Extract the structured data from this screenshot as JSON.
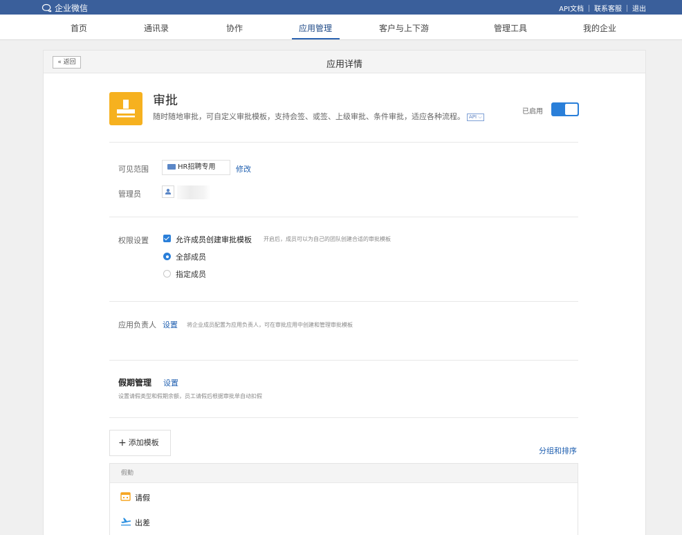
{
  "topbar": {
    "logo_text": "企业微信",
    "links": [
      "API文档",
      "联系客服",
      "退出"
    ]
  },
  "nav": {
    "items": [
      "首页",
      "通讯录",
      "协作",
      "应用管理",
      "客户与上下游",
      "管理工具",
      "我的企业"
    ],
    "active": "应用管理"
  },
  "page": {
    "back_label": "« 返回",
    "title": "应用详情"
  },
  "app": {
    "name": "审批",
    "description": "随时随地审批，可自定义审批模板，支持会签、或签、上级审批、条件审批，适应各种流程。",
    "api_tag": "API",
    "status_label": "已启用",
    "enabled": true,
    "icon_color": "#f6b11f"
  },
  "visibility": {
    "label": "可见范围",
    "value": "HR招聘专用",
    "edit_label": "修改"
  },
  "admin": {
    "label": "管理员"
  },
  "permission": {
    "label": "权限设置",
    "checkbox_label": "允许成员创建审批模板",
    "checkbox_checked": true,
    "hint": "开启后，成员可以为自己的团队创建合适的审批模板",
    "options": [
      "全部成员",
      "指定成员"
    ],
    "selected": "全部成员"
  },
  "owner": {
    "label": "应用负责人",
    "link_label": "设置",
    "hint": "将企业成员配置为应用负责人，可在审批应用中创建和管理审批模板"
  },
  "leave": {
    "title": "假期管理",
    "link_label": "设置",
    "hint": "设置请假类型和假期余额，员工请假后根据审批单自动扣假"
  },
  "templates": {
    "add_label": "添加模板",
    "group_sort_label": "分组和排序",
    "group_name": "假勤",
    "items": [
      {
        "name": "请假",
        "icon": "calendar-icon"
      },
      {
        "name": "出差",
        "icon": "airplane-icon"
      }
    ]
  },
  "colors": {
    "topbar": "#3a5f9b",
    "accent": "#2a7fd9",
    "link": "#1f5fb0"
  }
}
